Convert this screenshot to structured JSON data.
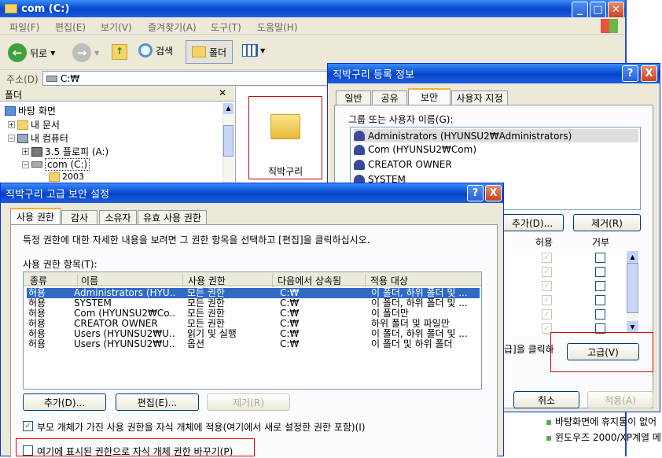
{
  "explorer": {
    "title": "com (C:)",
    "menu": [
      "파일(F)",
      "편집(E)",
      "보기(V)",
      "즐겨찾기(A)",
      "도구(T)",
      "도움말(H)"
    ],
    "back": "뒤로",
    "search": "검색",
    "folders": "폴더",
    "address_label": "주소(D)",
    "address": "C:₩",
    "folder_pane_title": "폴더",
    "tree": [
      {
        "label": "바탕 화면"
      },
      {
        "label": "내 문서"
      },
      {
        "label": "내 컴퓨터"
      },
      {
        "label": "3.5 플로피 (A:)"
      },
      {
        "label": "com (C:)"
      },
      {
        "label": "2003"
      }
    ],
    "folder_item": "직박구리"
  },
  "props": {
    "title": "직박구리 등록 정보",
    "help": "?",
    "close": "X",
    "tabs": [
      "일반",
      "공유",
      "보안",
      "사용자 지정"
    ],
    "group_label": "그룹 또는 사용자 이름(G):",
    "users": [
      "Administrators (HYUNSU2₩Administrators)",
      "Com (HYUNSU2₩Com)",
      "CREATOR OWNER",
      "SYSTEM"
    ],
    "add": "추가(D)...",
    "remove": "제거(R)",
    "allow": "허용",
    "deny": "거부",
    "advanced_text": "급]을 클릭하",
    "advanced": "고급(V)",
    "cancel": "취소",
    "apply": "적용(A)"
  },
  "advanced": {
    "title": "직박구리 고급 보안 설정",
    "help": "?",
    "close": "X",
    "tabs": [
      "사용 권한",
      "감사",
      "소유자",
      "유효 사용 권한"
    ],
    "desc": "특정 권한에 대한 자세한 내용을 보려면 그 권한 항목을 선택하고 [편집]을 클릭하십시오.",
    "list_label": "사용 권한 항목(T):",
    "columns": [
      "종류",
      "이름",
      "사용 권한",
      "다음에서 상속됨",
      "적용 대상"
    ],
    "rows": [
      [
        "허용",
        "Administrators (HYU...",
        "모든 권한",
        "C:₩",
        "이 폴더, 하위 폴더 및 ..."
      ],
      [
        "허용",
        "SYSTEM",
        "모든 권한",
        "C:₩",
        "이 폴더, 하위 폴더 및 ..."
      ],
      [
        "허용",
        "Com (HYUNSU2₩Co...",
        "모든 권한",
        "C:₩",
        "이 폴더만"
      ],
      [
        "허용",
        "CREATOR OWNER",
        "모든 권한",
        "C:₩",
        "하위 폴더 및 파일만"
      ],
      [
        "허용",
        "Users (HYUNSU2₩U...",
        "읽기 및 실행",
        "C:₩",
        "이 폴더, 하위 폴더 및 ..."
      ],
      [
        "허용",
        "Users (HYUNSU2₩U...",
        "옵션",
        "C:₩",
        "이 폴더 및 하위 폴더"
      ]
    ],
    "add": "추가(D)...",
    "edit": "편집(E)...",
    "remove": "제거(R)",
    "inherit_label": "부모 개체가 가진 사용 권한을 자식 개체에 적용(여기에서 새로 설정한 권한 포함)(I)",
    "replace_label": "여기에 표시된 권한으로 자식 개체 권한 바꾸기(P)"
  },
  "webpage": {
    "bullets": [
      "바탕화면에 휴지통이 없어",
      "윈도우즈 2000/XP계열 메"
    ]
  }
}
